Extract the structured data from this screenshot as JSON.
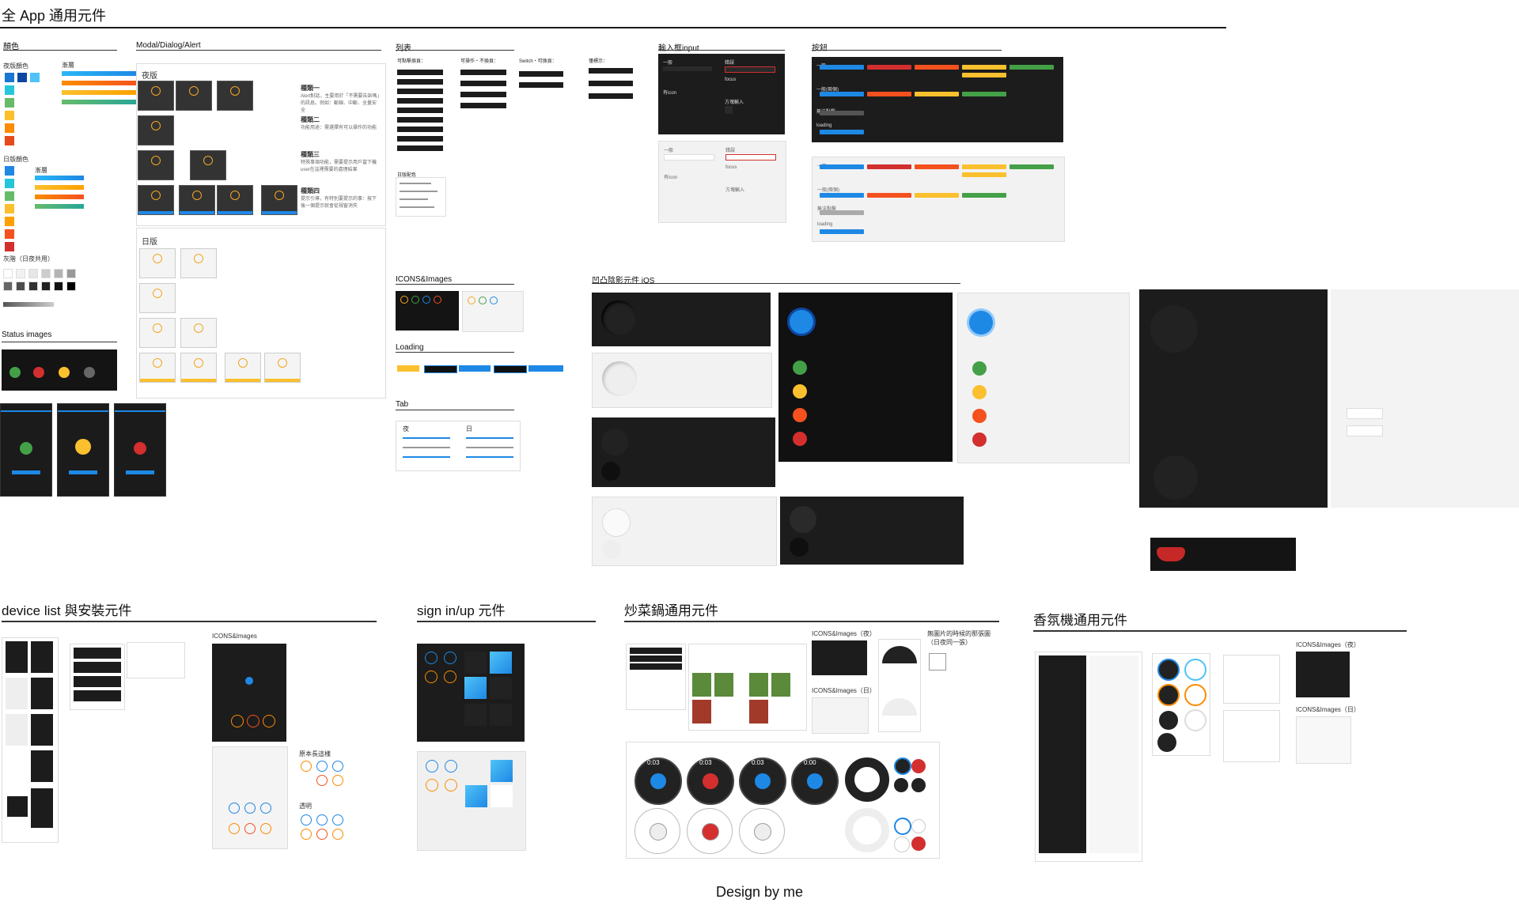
{
  "page": {
    "title": "全 App 通用元件",
    "footer": "Design by me"
  },
  "colors": {
    "title": "顏色",
    "night_label": "夜版顏色",
    "day_label": "日版顏色",
    "gradient_label": "漸層",
    "gray_label": "灰階（日夜共用）",
    "night_swatches": [
      "#1976d2",
      "#0d47a1",
      "#4fc3f7",
      "#26c6da",
      "#66bb6a",
      "#fbc02d",
      "#fb8c00",
      "#e64a19",
      "#c62828"
    ],
    "day_swatches": [
      "#1e88e5",
      "#26c6da",
      "#66bb6a",
      "#fbc02d",
      "#ffa000",
      "#f4511e",
      "#d32f2f"
    ],
    "grays": [
      "#ffffff",
      "#f2f2f2",
      "#e6e6e6",
      "#cccccc",
      "#b3b3b3",
      "#999999",
      "#666666",
      "#4d4d4d",
      "#333333",
      "#222222",
      "#111111",
      "#000000"
    ]
  },
  "status_images": {
    "title": "Status images"
  },
  "modal": {
    "title": "Modal/Dialog/Alert",
    "night_label": "夜版",
    "day_label": "日版",
    "types": [
      {
        "name": "種類一",
        "desc": "Alert對話，主要用於「不需要告訴嗎」的訊息。例如：斷線、中斷、全量安全"
      },
      {
        "name": "種類二",
        "desc": "功能用途：需選擇有可以操作的功能"
      },
      {
        "name": "種類三",
        "desc": "特殊事項功能，需要提示用戶當下機user在這裡需要的處理結果"
      },
      {
        "name": "種類四",
        "desc": "提示引導，有特別要提示的事：按下後一個提示就會從視窗消失"
      }
    ]
  },
  "list": {
    "title": "列表",
    "cols": [
      "可點擊換頁：",
      "可操作・不換頁：",
      "Switch・可換頁：",
      "僅標示："
    ],
    "day_color_label": "日版配色"
  },
  "icons_images": {
    "title": "ICONS&Images"
  },
  "loading": {
    "title": "Loading"
  },
  "tab": {
    "title": "Tab",
    "night": "夜",
    "day": "日"
  },
  "input": {
    "title": "輸入框input",
    "general": "一般",
    "error": "錯誤",
    "with_icon": "有icon",
    "focus": "focus",
    "box": "方塊輸入"
  },
  "buttons": {
    "title": "按鈕",
    "rows": [
      "一般",
      "一般(兩個)",
      "無法點擊",
      "loading"
    ],
    "colors": [
      "#1e88e5",
      "#d32f2f",
      "#f4511e",
      "#fbc02d",
      "#43a047"
    ]
  },
  "neumorph": {
    "title": "凹凸陰影元件 iOS"
  },
  "device_list": {
    "title": "device list 與安裝元件",
    "icons_label": "ICONS&Images",
    "original_label": "原本長這樣",
    "transparent_label": "透明"
  },
  "signin": {
    "title": "sign in/up 元件"
  },
  "wok": {
    "title": "炒菜鍋通用元件",
    "icons_night": "ICONS&Images（夜）",
    "icons_day": "ICONS&Images（日）",
    "no_image_note": "無圖片的時候的那張圖（日夜同一張）",
    "timers": [
      "0:03",
      "0:03",
      "0:03",
      "0:00"
    ]
  },
  "aroma": {
    "title": "香氛機通用元件",
    "icons_night": "ICONS&Images（夜）",
    "icons_day": "ICONS&Images（日）"
  }
}
